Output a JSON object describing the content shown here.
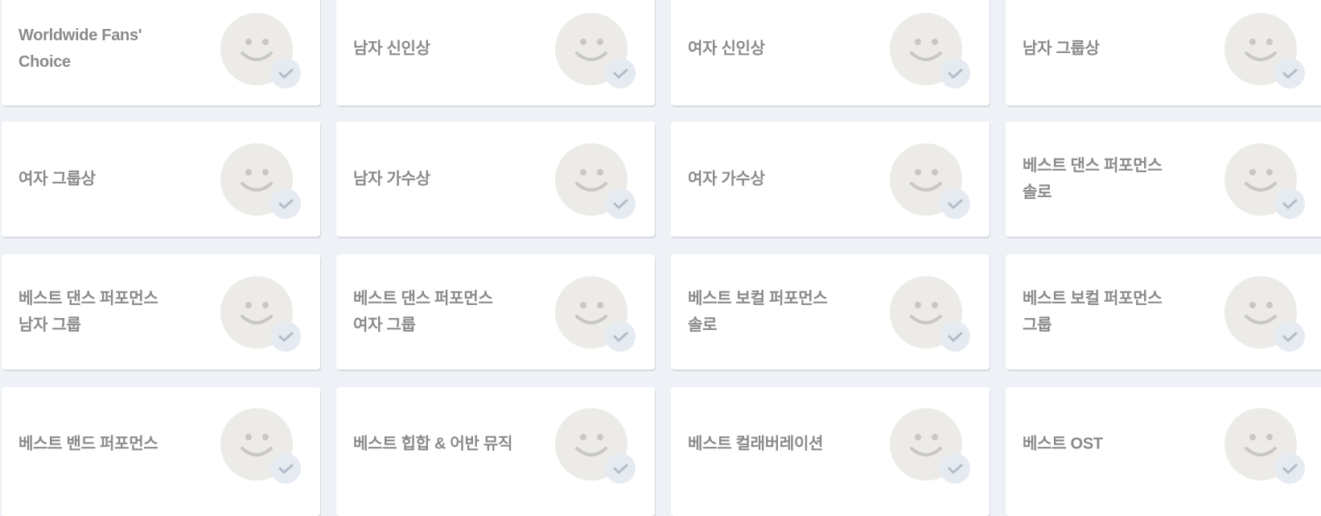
{
  "categories": [
    {
      "label": "Worldwide Fans' Choice"
    },
    {
      "label": "남자 신인상"
    },
    {
      "label": "여자 신인상"
    },
    {
      "label": "남자 그룹상"
    },
    {
      "label": "여자 그룹상"
    },
    {
      "label": "남자 가수상"
    },
    {
      "label": "여자 가수상"
    },
    {
      "label": "베스트 댄스 퍼포먼스\n솔로"
    },
    {
      "label": "베스트 댄스 퍼포먼스\n남자 그룹"
    },
    {
      "label": "베스트 댄스 퍼포먼스\n여자 그룹"
    },
    {
      "label": "베스트 보컬 퍼포먼스\n솔로"
    },
    {
      "label": "베스트 보컬 퍼포먼스\n그룹"
    },
    {
      "label": "베스트 밴드 퍼포먼스"
    },
    {
      "label": "베스트 힙합 & 어반 뮤직"
    },
    {
      "label": "베스트 컬래버레이션"
    },
    {
      "label": "베스트 OST"
    }
  ],
  "icons": {
    "avatar": "smiley-face-icon",
    "check": "check-icon"
  },
  "colors": {
    "background": "#eef1f6",
    "card": "#ffffff",
    "label": "#8a8a8a",
    "avatar": "#ecebe7",
    "check_badge": "#e6ebf1",
    "check_mark": "#b3bcc8"
  }
}
